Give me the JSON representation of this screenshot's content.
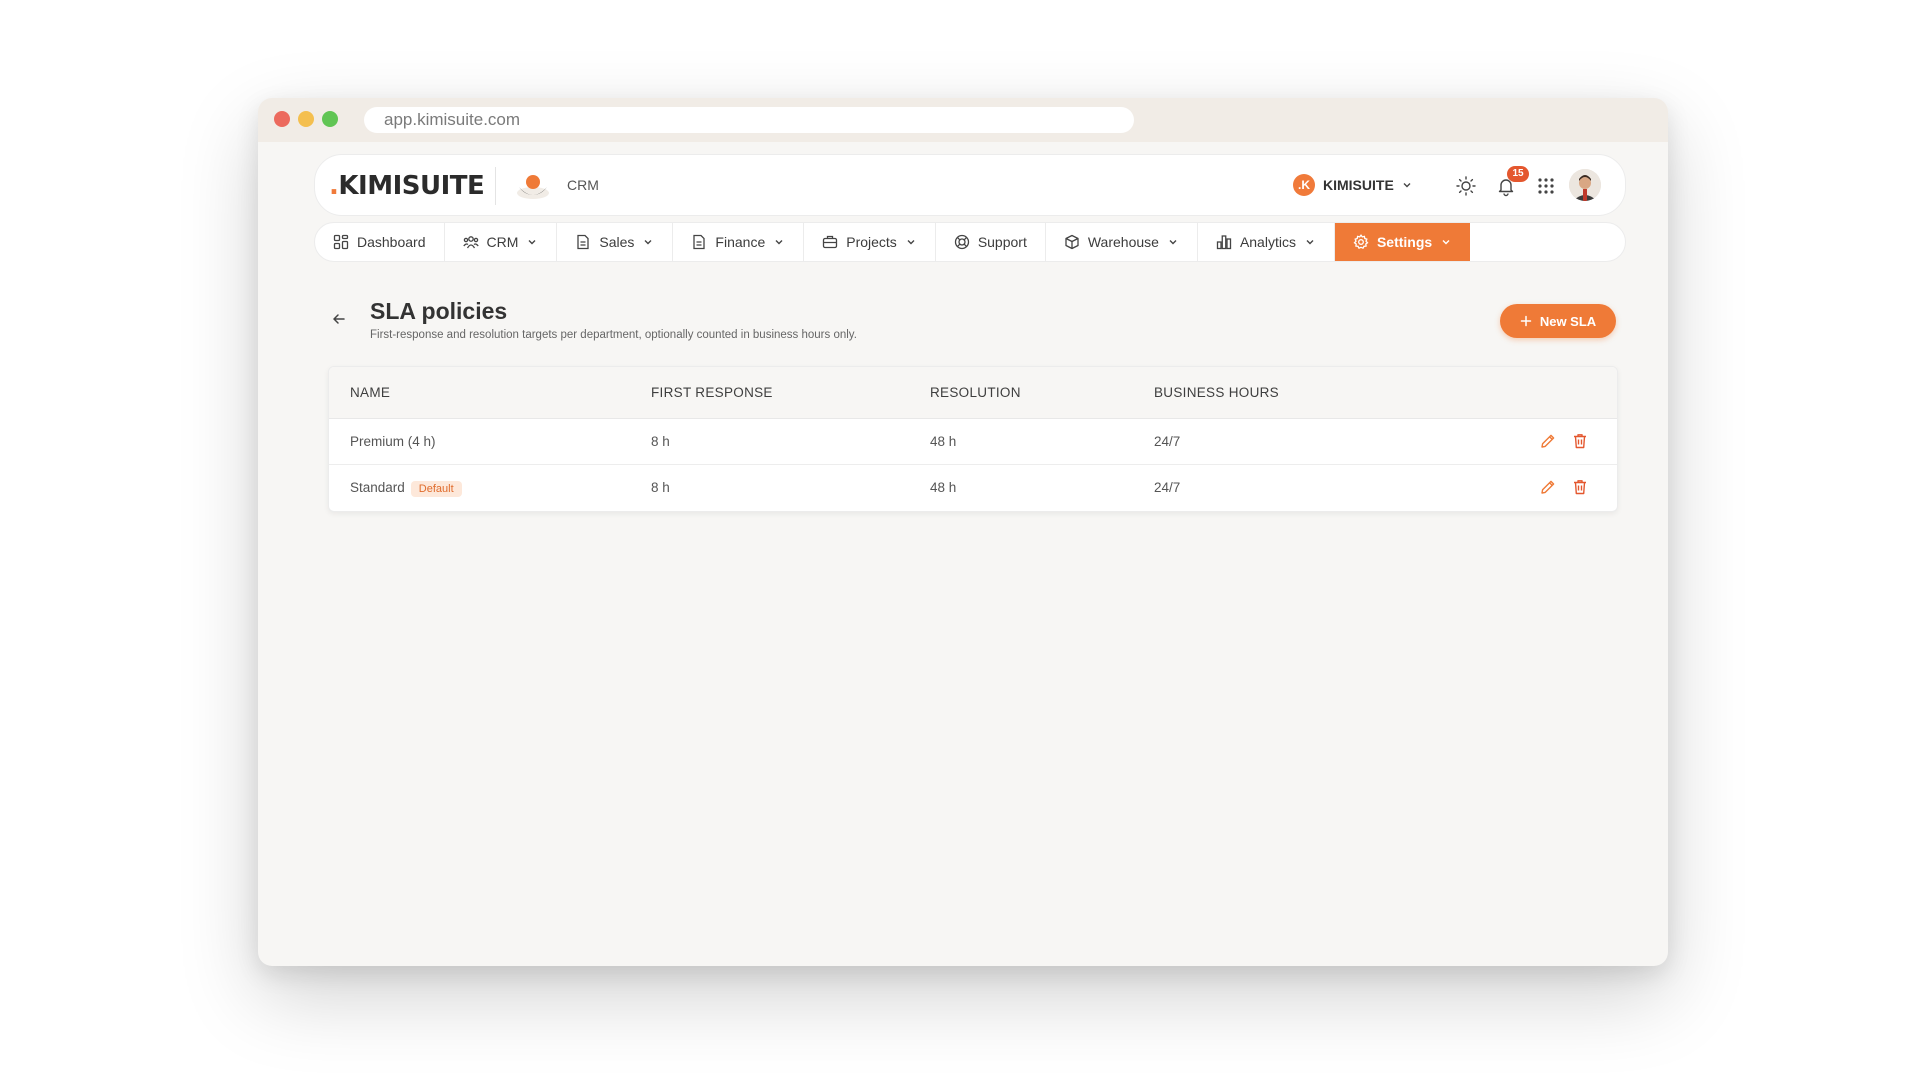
{
  "browser": {
    "url": "app.kimisuite.com"
  },
  "header": {
    "logo_dot": ".",
    "logo_text": "KIMISUITE",
    "module_label": "CRM",
    "org_initial": ".K",
    "org_name": "KIMISUITE",
    "notification_count": "15"
  },
  "nav": {
    "items": [
      {
        "label": "Dashboard",
        "icon": "grid-icon"
      },
      {
        "label": "CRM",
        "icon": "users-icon"
      },
      {
        "label": "Sales",
        "icon": "document-icon"
      },
      {
        "label": "Finance",
        "icon": "document-icon"
      },
      {
        "label": "Projects",
        "icon": "briefcase-icon"
      },
      {
        "label": "Support",
        "icon": "lifebuoy-icon"
      },
      {
        "label": "Warehouse",
        "icon": "box-icon"
      },
      {
        "label": "Analytics",
        "icon": "bar-chart-icon"
      },
      {
        "label": "Settings",
        "icon": "gear-icon"
      }
    ]
  },
  "page": {
    "title": "SLA policies",
    "subtitle": "First-response and resolution targets per department, optionally counted in business hours only.",
    "new_button": "New SLA"
  },
  "table": {
    "columns": [
      "NAME",
      "FIRST RESPONSE",
      "RESOLUTION",
      "BUSINESS HOURS"
    ],
    "rows": [
      {
        "name": "Premium (4 h)",
        "badge": "",
        "first_response": "8 h",
        "resolution": "48 h",
        "business_hours": "24/7"
      },
      {
        "name": "Standard",
        "badge": "Default",
        "first_response": "8 h",
        "resolution": "48 h",
        "business_hours": "24/7"
      }
    ]
  },
  "colors": {
    "accent": "#ef7a37",
    "badge_red": "#e4572e",
    "background": "#f7f6f4"
  }
}
